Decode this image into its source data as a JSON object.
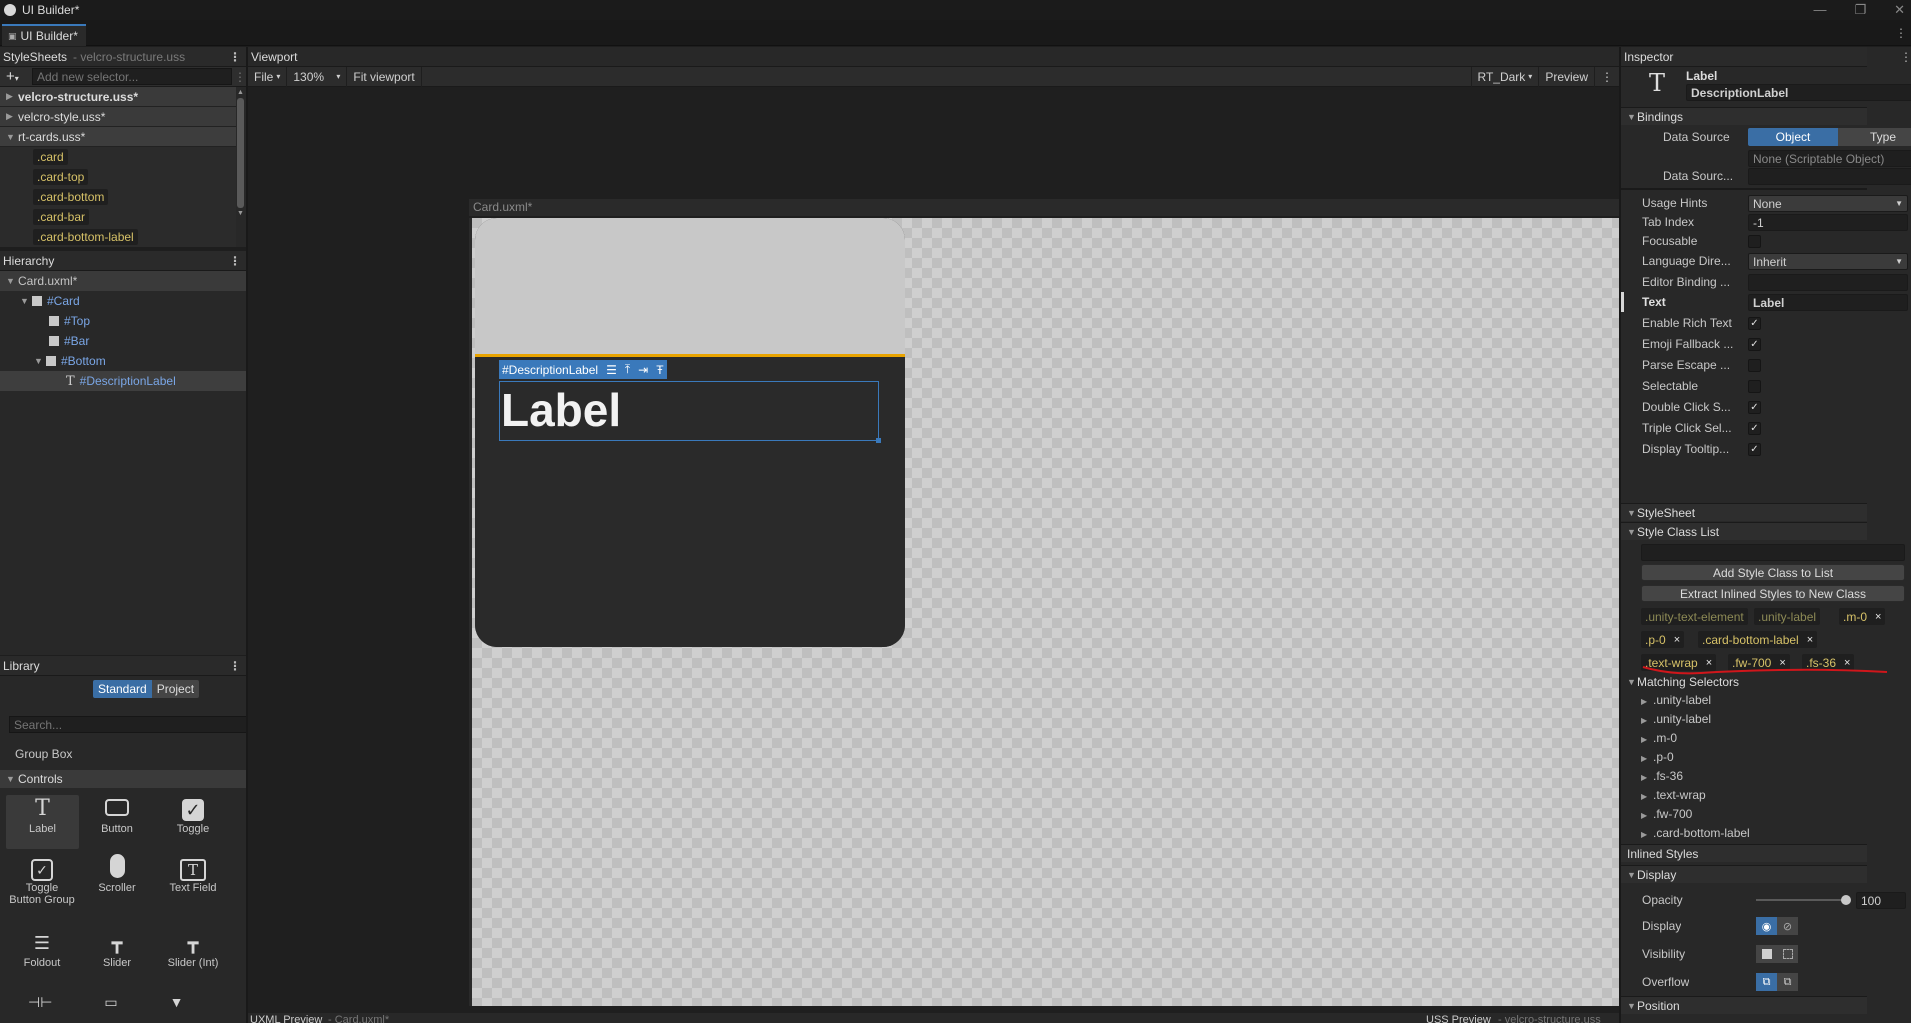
{
  "window": {
    "title": "UI Builder*",
    "tab": "UI Builder*"
  },
  "stylesheets": {
    "header": "StyleSheets",
    "current": "- velcro-structure.uss",
    "add_placeholder": "Add new selector...",
    "sheets": [
      {
        "name": "velcro-structure.uss*"
      },
      {
        "name": "velcro-style.uss*"
      },
      {
        "name": "rt-cards.uss*"
      }
    ],
    "selectors": [
      ".card",
      ".card-top",
      ".card-bottom",
      ".card-bar",
      ".card-bottom-label"
    ]
  },
  "hierarchy": {
    "header": "Hierarchy",
    "items": [
      {
        "label": "Card.uxml*"
      },
      {
        "label": "#Card"
      },
      {
        "label": "#Top"
      },
      {
        "label": "#Bar"
      },
      {
        "label": "#Bottom"
      },
      {
        "label": "#DescriptionLabel"
      }
    ]
  },
  "library": {
    "header": "Library",
    "tabs": [
      "Standard",
      "Project"
    ],
    "search_placeholder": "Search...",
    "group_box": "Group Box",
    "controls_header": "Controls",
    "items": [
      {
        "label": "Label",
        "icon": "label-icon"
      },
      {
        "label": "Button",
        "icon": "button-icon"
      },
      {
        "label": "Toggle",
        "icon": "toggle-icon"
      },
      {
        "label": "Toggle Button Group",
        "icon": "toggle-group-icon"
      },
      {
        "label": "Scroller",
        "icon": "scroller-icon"
      },
      {
        "label": "Text Field",
        "icon": "text-field-icon"
      },
      {
        "label": "Foldout",
        "icon": "foldout-icon"
      },
      {
        "label": "Slider",
        "icon": "slider-icon"
      },
      {
        "label": "Slider (Int)",
        "icon": "slider-int-icon"
      }
    ]
  },
  "viewport": {
    "header": "Viewport",
    "file": "File",
    "zoom": "130%",
    "fit": "Fit viewport",
    "theme": "RT_Dark",
    "preview": "Preview",
    "canvas_title": "Card.uxml*",
    "selected_name": "#DescriptionLabel",
    "label_text": "Label",
    "bottom_left": "UXML Preview",
    "bottom_left_sub": "- Card.uxml*",
    "bottom_right": "USS Preview",
    "bottom_right_sub": "- velcro-structure.uss"
  },
  "inspector": {
    "header": "Inspector",
    "element_type": "Label",
    "element_name": "DescriptionLabel",
    "bindings_header": "Bindings",
    "data_source_label": "Data Source",
    "data_source_tabs": [
      "Object",
      "Type"
    ],
    "data_source_value": "None (Scriptable Object)",
    "data_source_path_label": "Data Sourc...",
    "usage_hints_label": "Usage Hints",
    "usage_hints_value": "None",
    "tab_index_label": "Tab Index",
    "tab_index_value": "-1",
    "focusable_label": "Focusable",
    "language_label": "Language Dire...",
    "language_value": "Inherit",
    "editor_binding_label": "Editor Binding ...",
    "text_label": "Text",
    "text_value": "Label",
    "checks": [
      {
        "label": "Enable Rich Text",
        "checked": "✓"
      },
      {
        "label": "Emoji Fallback ...",
        "checked": "✓"
      },
      {
        "label": "Parse Escape ...",
        "checked": ""
      },
      {
        "label": "Selectable",
        "checked": ""
      },
      {
        "label": "Double Click S...",
        "checked": "✓"
      },
      {
        "label": "Triple Click Sel...",
        "checked": "✓"
      },
      {
        "label": "Display Tooltip...",
        "checked": "✓"
      }
    ],
    "stylesheet_header": "StyleSheet",
    "style_class_header": "Style Class List",
    "add_class_btn": "Add Style Class to List",
    "extract_btn": "Extract Inlined Styles to New Class",
    "classes": [
      {
        "name": ".unity-text-element",
        "x": ""
      },
      {
        "name": ".unity-label",
        "x": ""
      },
      {
        "name": ".m-0",
        "x": "×"
      },
      {
        "name": ".p-0",
        "x": "×"
      },
      {
        "name": ".card-bottom-label",
        "x": "×"
      },
      {
        "name": ".text-wrap",
        "x": "×"
      },
      {
        "name": ".fw-700",
        "x": "×"
      },
      {
        "name": ".fs-36",
        "x": "×"
      }
    ],
    "matching_header": "Matching Selectors",
    "matching": [
      ".unity-label",
      ".unity-label",
      ".m-0",
      ".p-0",
      ".fs-36",
      ".text-wrap",
      ".fw-700",
      ".card-bottom-label"
    ],
    "inlined_header": "Inlined Styles",
    "display_header": "Display",
    "opacity_label": "Opacity",
    "opacity_value": "100",
    "opacity_level": 1.0,
    "display_label": "Display",
    "visibility_label": "Visibility",
    "overflow_label": "Overflow",
    "position_header": "Position"
  },
  "colors": {
    "accent": "#3a79bb",
    "selector_text": "#d7c268",
    "card_top": "#c8c8c8",
    "card_bar": "#e8a300",
    "card_bottom": "#2a2a2a",
    "annotation_red": "#d0161b"
  }
}
